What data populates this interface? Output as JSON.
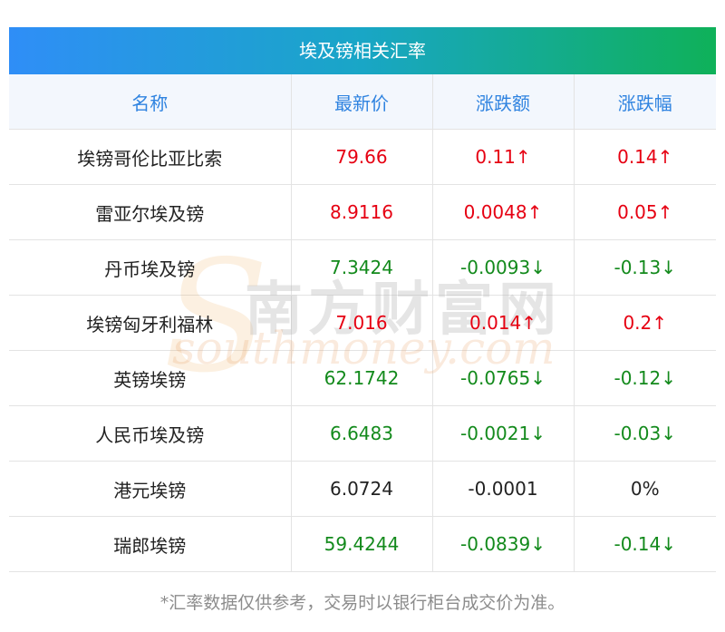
{
  "title": "埃及镑相关汇率",
  "headers": [
    "名称",
    "最新价",
    "涨跌额",
    "涨跌幅"
  ],
  "rows": [
    {
      "name": "埃镑哥伦比亚比索",
      "price": "79.66",
      "change": "0.11↑",
      "pct": "0.14↑",
      "dir": "up"
    },
    {
      "name": "雷亚尔埃及镑",
      "price": "8.9116",
      "change": "0.0048↑",
      "pct": "0.05↑",
      "dir": "up"
    },
    {
      "name": "丹币埃及镑",
      "price": "7.3424",
      "change": "-0.0093↓",
      "pct": "-0.13↓",
      "dir": "down"
    },
    {
      "name": "埃镑匈牙利福林",
      "price": "7.016",
      "change": "0.014↑",
      "pct": "0.2↑",
      "dir": "up"
    },
    {
      "name": "英镑埃镑",
      "price": "62.1742",
      "change": "-0.0765↓",
      "pct": "-0.12↓",
      "dir": "down"
    },
    {
      "name": "人民币埃及镑",
      "price": "6.6483",
      "change": "-0.0021↓",
      "pct": "-0.03↓",
      "dir": "down"
    },
    {
      "name": "港元埃镑",
      "price": "6.0724",
      "change": "-0.0001",
      "pct": "0%",
      "dir": "flat"
    },
    {
      "name": "瑞郎埃镑",
      "price": "59.4244",
      "change": "-0.0839↓",
      "pct": "-0.14↓",
      "dir": "down"
    }
  ],
  "footnote": "*汇率数据仅供参考，交易时以银行柜台成交价为准。",
  "watermark": {
    "cn": "南方财富网",
    "en": "southmoney.com",
    "s": "S"
  },
  "colors": {
    "up": "#e60012",
    "down": "#138a1c",
    "header_text": "#2f83e0",
    "footnote": "#8c8c8c"
  }
}
